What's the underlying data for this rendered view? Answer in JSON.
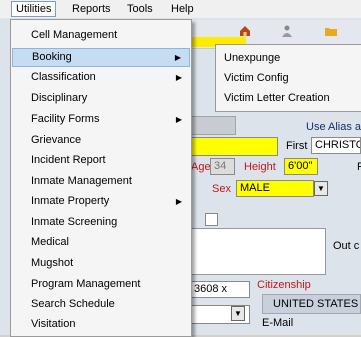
{
  "menubar": {
    "items": [
      "Utilities",
      "Reports",
      "Tools",
      "Help"
    ]
  },
  "utilities_menu": {
    "items": [
      {
        "label": "Cell Management",
        "has_submenu": false
      },
      {
        "label": "Booking",
        "has_submenu": true
      },
      {
        "label": "Classification",
        "has_submenu": true
      },
      {
        "label": "Disciplinary",
        "has_submenu": false
      },
      {
        "label": "Facility Forms",
        "has_submenu": true
      },
      {
        "label": "Grievance",
        "has_submenu": false
      },
      {
        "label": "Incident Report",
        "has_submenu": false
      },
      {
        "label": "Inmate Management",
        "has_submenu": false
      },
      {
        "label": "Inmate Property",
        "has_submenu": true
      },
      {
        "label": "Inmate Screening",
        "has_submenu": false
      },
      {
        "label": "Medical",
        "has_submenu": false
      },
      {
        "label": "Mugshot",
        "has_submenu": false
      },
      {
        "label": "Program Management",
        "has_submenu": false
      },
      {
        "label": "Search Schedule",
        "has_submenu": false
      },
      {
        "label": "Visitation",
        "has_submenu": false
      }
    ],
    "highlighted": "Booking",
    "arrow_glyph": "▶"
  },
  "booking_submenu": {
    "items": [
      "Unexpunge",
      "Victim Config",
      "Victim Letter Creation"
    ]
  },
  "form": {
    "use_alias_label": "Use Alias a",
    "first_label": "First",
    "first_value": "CHRISTO",
    "first_suffix": "F",
    "age_label": "Age",
    "age_value": "34",
    "height_label": "Height",
    "height_value": "6'00\"",
    "sex_label": "Sex",
    "sex_value": "MALE",
    "out_label": "Out c",
    "phone_value": "3608 x",
    "citizenship_label": "Citizenship",
    "citizenship_value": "UNITED STATES",
    "email_label": "E-Mail",
    "combo_glyph": "▼"
  },
  "colors": {
    "highlight": "#c5dcf2",
    "required_field": "#ffff00",
    "label_red": "#c01818"
  }
}
